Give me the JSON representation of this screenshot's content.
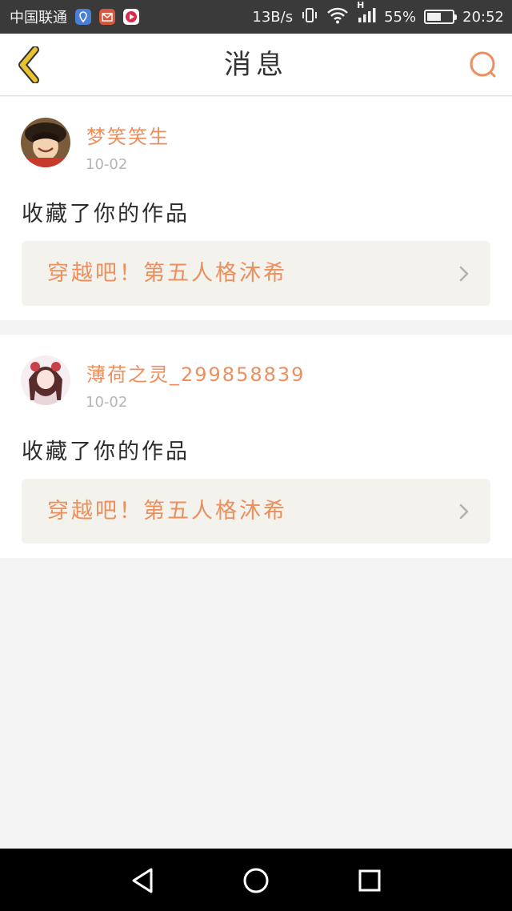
{
  "status_bar": {
    "carrier": "中国联通",
    "speed": "13B/s",
    "battery": "55%",
    "battery_level": 0.55,
    "time": "20:52",
    "network_type": "H"
  },
  "nav": {
    "title": "消息",
    "back_icon": "chevron-left-icon",
    "search_icon": "search-icon"
  },
  "messages": [
    {
      "username": "梦笑笑生",
      "date": "10-02",
      "action": "收藏了你的作品",
      "work_title": "穿越吧！第五人格沐希"
    },
    {
      "username": "薄荷之灵_299858839",
      "date": "10-02",
      "action": "收藏了你的作品",
      "work_title": "穿越吧！第五人格沐希"
    }
  ],
  "colors": {
    "accent": "#ec8f5c",
    "back_icon": "#e8c230",
    "card_link_bg": "#f3f2ed"
  }
}
